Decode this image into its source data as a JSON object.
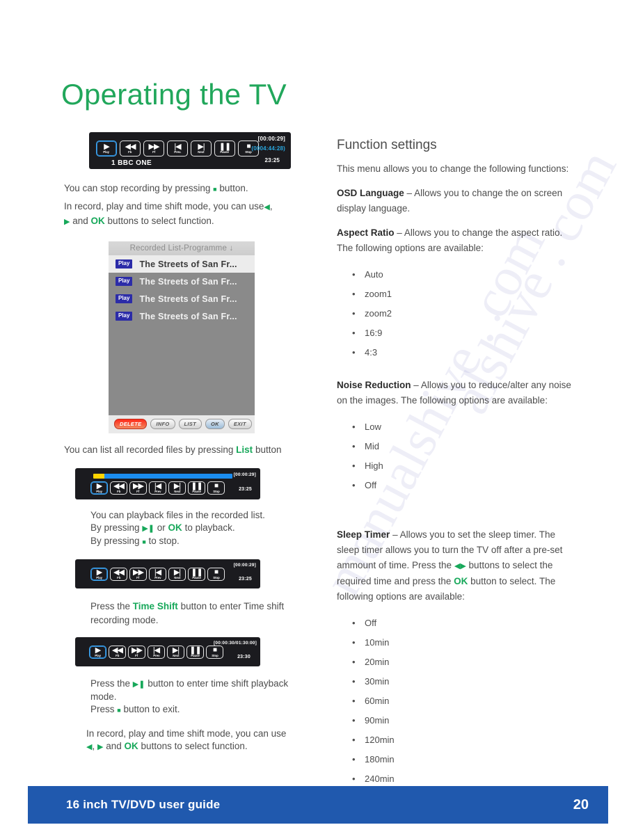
{
  "page_title": "Operating the TV",
  "watermark": [
    "manualshive . com",
    "alshive . com"
  ],
  "player_bar_1": {
    "buttons": [
      {
        "glyph": "▶",
        "caption": "Play",
        "selected": true
      },
      {
        "glyph": "◀◀",
        "caption": "Fb",
        "selected": false
      },
      {
        "glyph": "▶▶",
        "caption": "Ff",
        "selected": false
      },
      {
        "glyph": "|◀",
        "caption": "Prev.",
        "selected": false
      },
      {
        "glyph": "▶|",
        "caption": "Next",
        "selected": false
      },
      {
        "glyph": "❚❚",
        "caption": "Pause",
        "selected": false
      },
      {
        "glyph": "■",
        "caption": "Stop",
        "selected": false
      }
    ],
    "channel": "1  BBC ONE",
    "time_elapsed": "[00:00:29]",
    "time_total": "(0004:44:28)",
    "clock": "23:25"
  },
  "text_stop_recording": {
    "line1_before": "You can stop recording by pressing",
    "line1_symbol": "■",
    "line1_after": "button.",
    "line2_before": "In record, play and time shift mode, you can use",
    "line2_sym_left": "◀",
    "line2_comma": ",",
    "line3_sym_right": "▶",
    "line3_and": "and",
    "line3_ok": "OK",
    "line3_after": "buttons to select function."
  },
  "recorded_list": {
    "header": "Recorded List-Programme ↓",
    "rows": [
      {
        "badge": "Play",
        "title": "The Streets of San Fr..."
      },
      {
        "badge": "Play",
        "title": "The Streets of San Fr..."
      },
      {
        "badge": "Play",
        "title": "The Streets of San Fr..."
      },
      {
        "badge": "Play",
        "title": "The Streets of San Fr..."
      }
    ],
    "controls": [
      "DELETE",
      "INFO",
      "LIST",
      "OK",
      "EXIT"
    ]
  },
  "text_list_files": {
    "before": "You can list all recorded files by pressing",
    "highlight": "List",
    "after": "button"
  },
  "player_bar_2": {
    "progress": {
      "yellow_pct": 8,
      "blue_pct": 92
    },
    "buttons": [
      {
        "glyph": "▶",
        "caption": "Play",
        "selected": true
      },
      {
        "glyph": "◀◀",
        "caption": "Fb",
        "selected": false
      },
      {
        "glyph": "▶▶",
        "caption": "Ff",
        "selected": false
      },
      {
        "glyph": "|◀",
        "caption": "Prev",
        "selected": false
      },
      {
        "glyph": "▶|",
        "caption": "Next",
        "selected": false
      },
      {
        "glyph": "❚❚",
        "caption": "Pause",
        "selected": false
      },
      {
        "glyph": "■",
        "caption": "Stop",
        "selected": false
      }
    ],
    "time_elapsed": "[00:00:29]",
    "clock": "23:25"
  },
  "text_playback": {
    "line1": "You can playback files in the recorded list.",
    "line2_before": "By pressing",
    "line2_symbol": "▶❚",
    "line2_or": "or",
    "line2_ok": "OK",
    "line2_after": "to playback.",
    "line3_before": "By pressing",
    "line3_symbol": "■",
    "line3_after": "to stop."
  },
  "player_bar_3": {
    "buttons": [
      {
        "glyph": "▶",
        "caption": "Play",
        "selected": true
      },
      {
        "glyph": "◀◀",
        "caption": "Fb",
        "selected": false
      },
      {
        "glyph": "▶▶",
        "caption": "Ff",
        "selected": false
      },
      {
        "glyph": "|◀",
        "caption": "Prev",
        "selected": false
      },
      {
        "glyph": "▶|",
        "caption": "Next",
        "selected": false
      },
      {
        "glyph": "❚❚",
        "caption": "Pause",
        "selected": false
      },
      {
        "glyph": "■",
        "caption": "Stop",
        "selected": false
      }
    ],
    "time_elapsed": "[00:00:29]",
    "clock": "23:25"
  },
  "text_time_shift": {
    "before": "Press the",
    "highlight": "Time Shift",
    "after": "button to enter Time shift recording mode."
  },
  "player_bar_4": {
    "buttons": [
      {
        "glyph": "▶",
        "caption": "Play",
        "selected": true
      },
      {
        "glyph": "◀◀",
        "caption": "Fb",
        "selected": false
      },
      {
        "glyph": "▶▶",
        "caption": "Ff",
        "selected": false
      },
      {
        "glyph": "|◀",
        "caption": "Prev",
        "selected": false
      },
      {
        "glyph": "▶|",
        "caption": "Next",
        "selected": false
      },
      {
        "glyph": "❚❚",
        "caption": "Pause",
        "selected": false
      },
      {
        "glyph": "■",
        "caption": "Stop",
        "selected": false
      }
    ],
    "time_elapsed": "[00:00:30/01:30:00]",
    "clock": "23:30"
  },
  "text_timeshift_playback": {
    "line1_before": "Press the",
    "line1_symbol": "▶❚",
    "line1_after": "button to enter time shift playback mode.",
    "line2_before": "Press",
    "line2_symbol": "■",
    "line2_after": "button to exit.",
    "line3_before": "In record, play and time shift mode, you can use",
    "line3_sym_left": "◀",
    "line3_comma": ",",
    "line3_sym_right": "▶",
    "line3_and": "and",
    "line3_ok": "OK",
    "line3_after": "buttons to select function."
  },
  "function_settings": {
    "title": "Function settings",
    "intro": "This menu allows you to change the following functions:",
    "osd_language": {
      "label": "OSD Language",
      "dash": "–",
      "text": "Allows you to change the on screen display language."
    },
    "aspect_ratio": {
      "label": "Aspect Ratio",
      "dash": "–",
      "text": "Allows you to change the aspect ratio. The following options are available:",
      "options": [
        "Auto",
        "zoom1",
        "zoom2",
        "16:9",
        "4:3"
      ]
    },
    "noise_reduction": {
      "label": "Noise Reduction",
      "dash": "–",
      "text": "Allows you to reduce/alter any noise on the images. The following options are available:",
      "options": [
        "Low",
        "Mid",
        "High",
        "Off"
      ]
    },
    "sleep_timer": {
      "label": "Sleep Timer",
      "dash": "–",
      "text_part1": "Allows you to set the sleep timer. The sleep timer allows you to turn the TV off after a pre-set ammount of time. Press the",
      "sym_left": "◀",
      "sym_right": "▶",
      "text_part2": "buttons to select the required time and press the",
      "ok": "OK",
      "text_part3": "button to select. The following options are available:",
      "options": [
        "Off",
        "10min",
        "20min",
        "30min",
        "60min",
        "90min",
        "120min",
        "180min",
        "240min"
      ]
    }
  },
  "footer": {
    "title": "16 inch TV/DVD user guide",
    "page_number": "20"
  },
  "colors": {
    "title_green": "#21a75b",
    "accent_green": "#17a85a",
    "footer_blue": "#2059ae",
    "player_bg": "#1b1b1f",
    "progress_blue": "#1b8df0",
    "progress_yellow": "#ffd400"
  }
}
